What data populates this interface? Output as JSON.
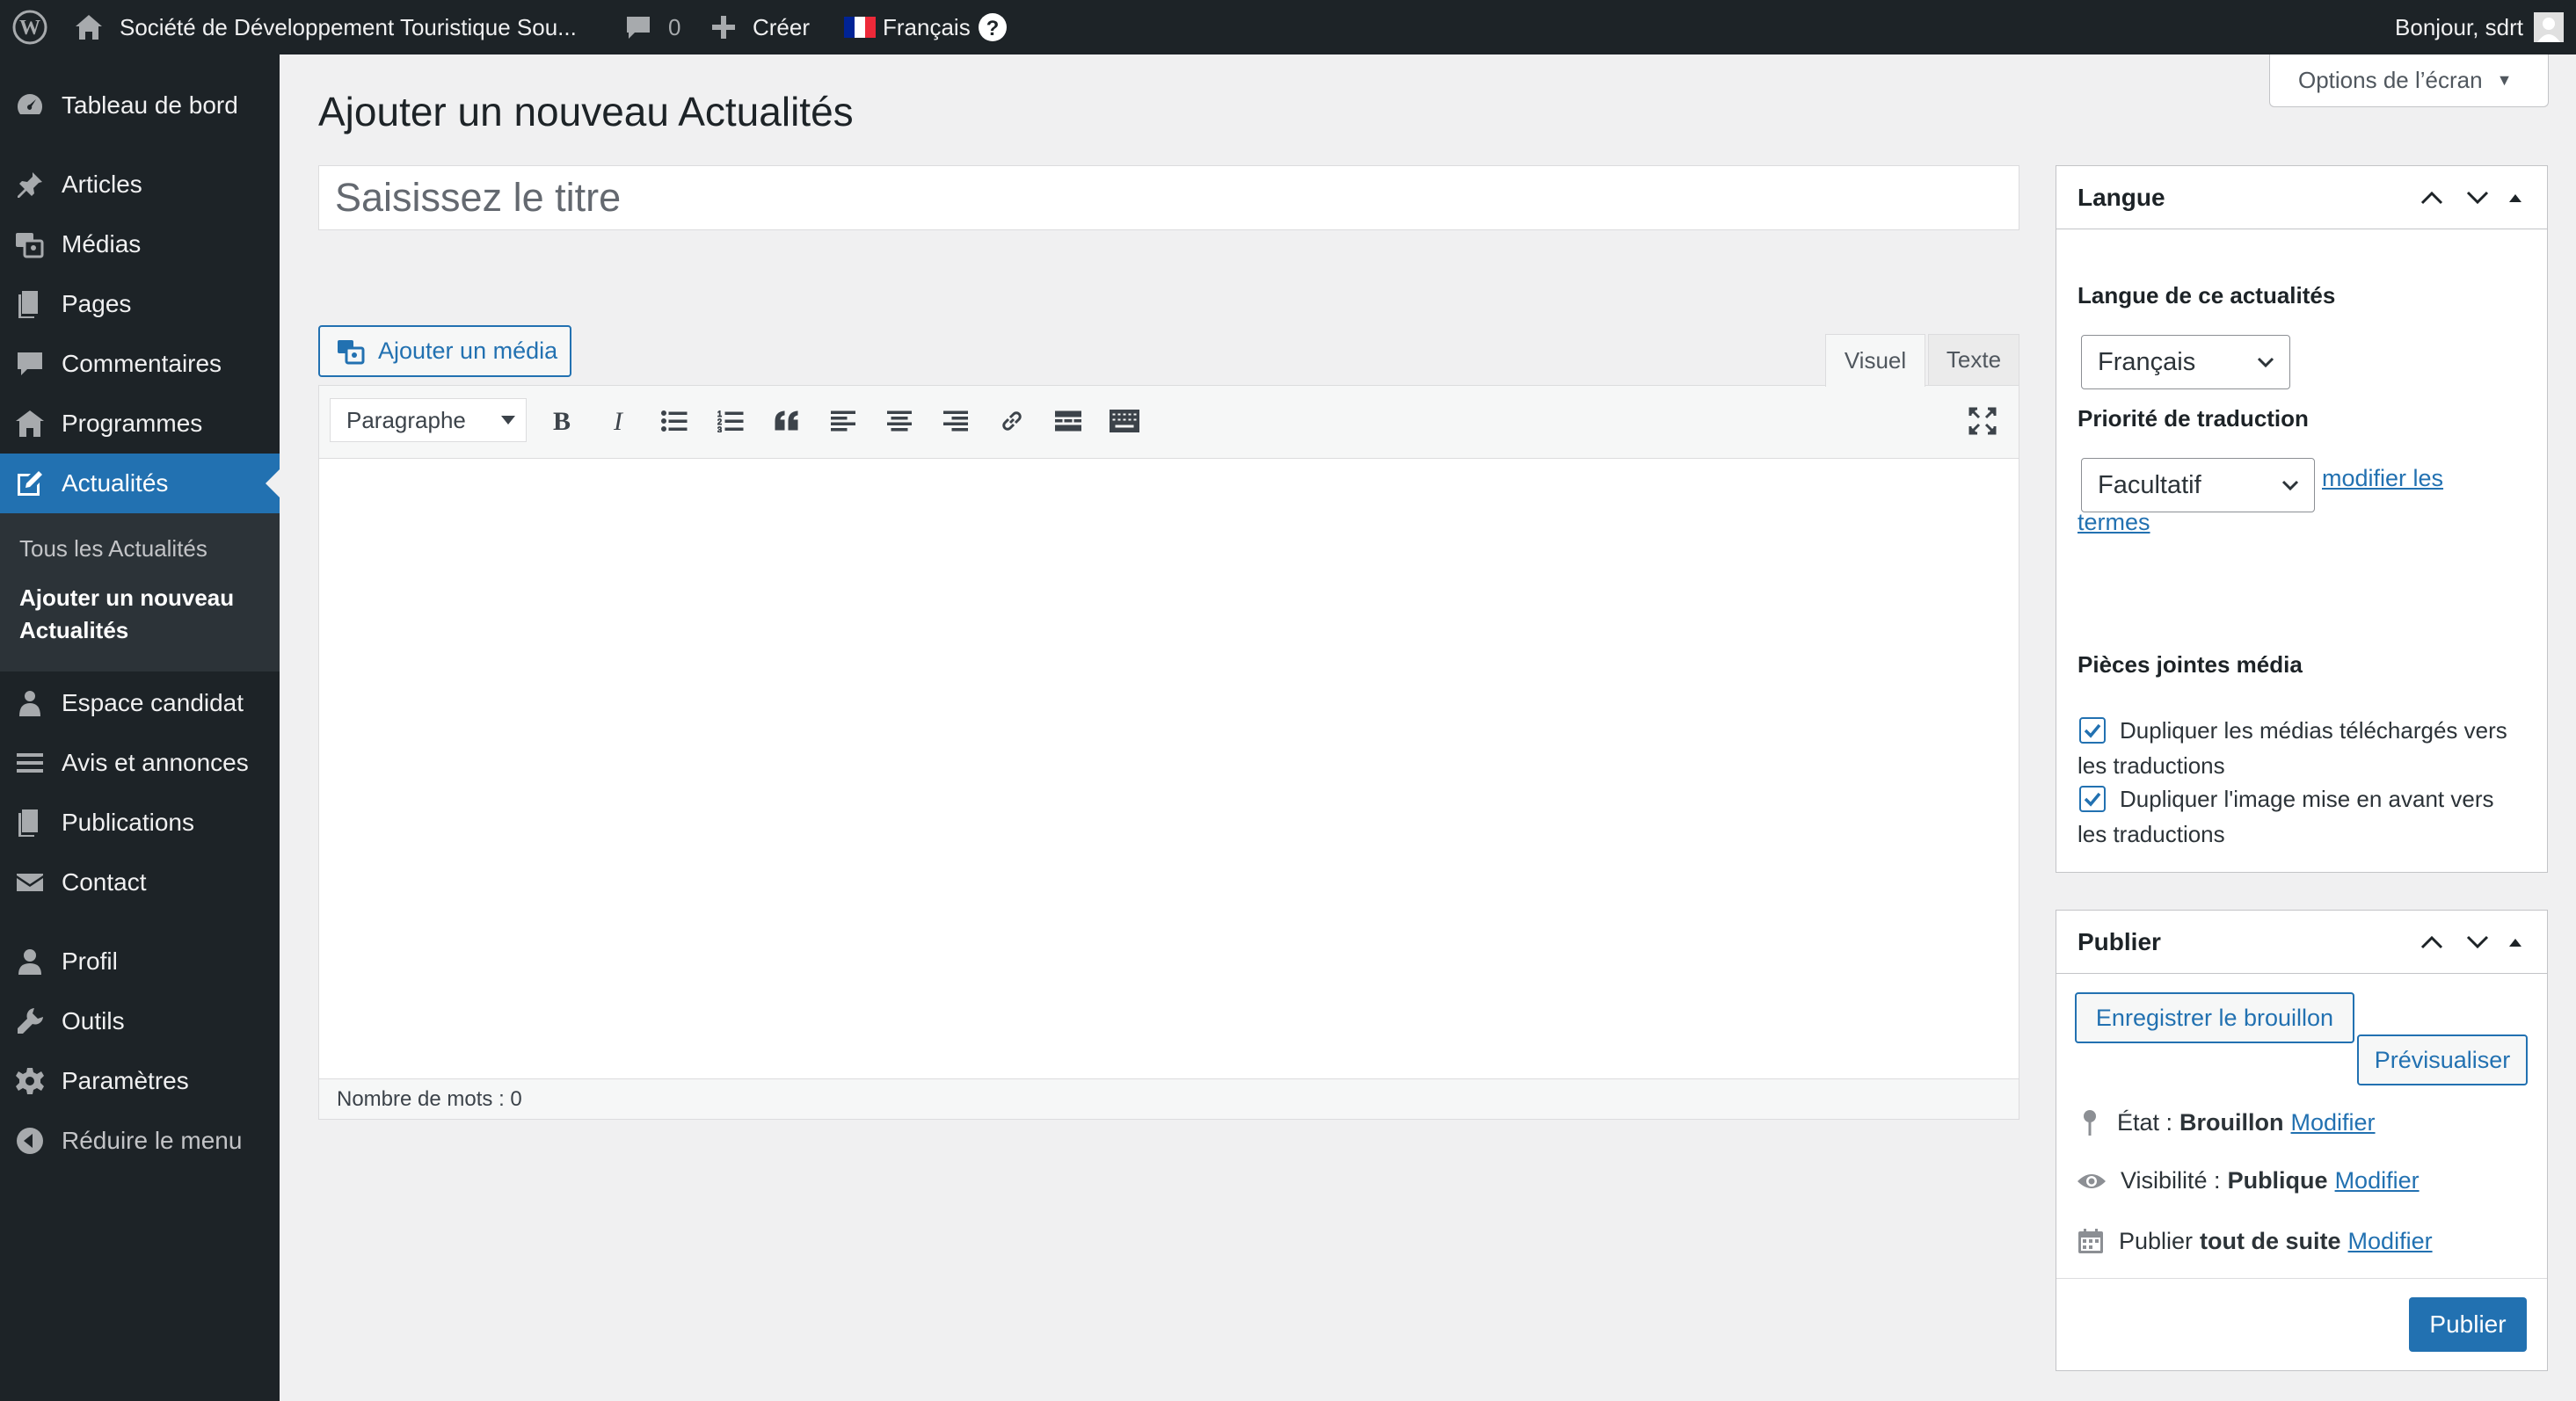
{
  "admin_bar": {
    "site_name": "Société de Développement Touristique Sou...",
    "comments_count": "0",
    "create_label": "Créer",
    "language_label": "Français",
    "greeting": "Bonjour, sdrt"
  },
  "sidebar": {
    "items": [
      {
        "label": "Tableau de bord",
        "icon": "dashboard-icon"
      },
      {
        "label": "Articles",
        "icon": "pin-icon"
      },
      {
        "label": "Médias",
        "icon": "media-icon"
      },
      {
        "label": "Pages",
        "icon": "pages-icon"
      },
      {
        "label": "Commentaires",
        "icon": "comments-icon"
      },
      {
        "label": "Programmes",
        "icon": "building-icon"
      },
      {
        "label": "Actualités",
        "icon": "edit-icon"
      },
      {
        "label": "Espace candidat",
        "icon": "users-icon"
      },
      {
        "label": "Avis et annonces",
        "icon": "list-icon"
      },
      {
        "label": "Publications",
        "icon": "pages-icon"
      },
      {
        "label": "Contact",
        "icon": "email-icon"
      },
      {
        "label": "Profil",
        "icon": "user-icon"
      },
      {
        "label": "Outils",
        "icon": "wrench-icon"
      },
      {
        "label": "Paramètres",
        "icon": "settings-icon"
      },
      {
        "label": "Réduire le menu",
        "icon": "collapse-icon"
      }
    ],
    "submenu": {
      "all_label": "Tous les Actualités",
      "add_new_line1": "Ajouter un nouveau",
      "add_new_line2": "Actualités"
    }
  },
  "screen_options_label": "Options de l’écran",
  "page_title": "Ajouter un nouveau Actualités",
  "title_placeholder": "Saisissez le titre",
  "editor": {
    "add_media_label": "Ajouter un média",
    "tab_visual": "Visuel",
    "tab_text": "Texte",
    "format_select": "Paragraphe",
    "word_count": "Nombre de mots : 0"
  },
  "langue_box": {
    "title": "Langue",
    "language_label": "Langue de ce actualités",
    "language_value": "Français",
    "priority_label": "Priorité de traduction",
    "priority_value": "Facultatif",
    "modify_terms_line1": "modifier les",
    "modify_terms_line2": "termes",
    "media_label": "Pièces jointes média",
    "dup_media_line1": "Dupliquer les médias téléchargés vers",
    "dup_media_line2": "les traductions",
    "dup_media_checked": true,
    "dup_featured_line1": "Dupliquer l'image mise en avant vers",
    "dup_featured_line2": "les traductions",
    "dup_featured_checked": true
  },
  "publish_box": {
    "title": "Publier",
    "save_draft": "Enregistrer le brouillon",
    "preview": "Prévisualiser",
    "status_label": "État :",
    "status_value": "Brouillon",
    "visibility_label": "Visibilité :",
    "visibility_value": "Publique",
    "publish_label": "Publier",
    "publish_value": "tout de suite",
    "modify_link": "Modifier",
    "publish_button": "Publier"
  },
  "colors": {
    "admin_dark": "#1d2327",
    "accent": "#2271b1",
    "background": "#f0f0f1"
  }
}
